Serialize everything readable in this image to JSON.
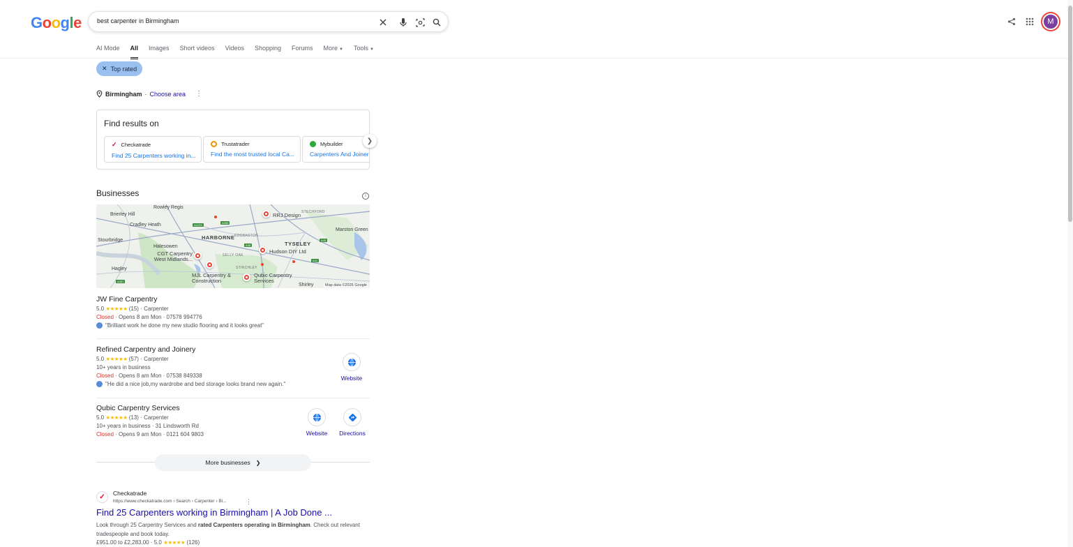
{
  "search": {
    "query": "best carpenter in Birmingham"
  },
  "tabs": [
    "AI Mode",
    "All",
    "Images",
    "Short videos",
    "Videos",
    "Shopping",
    "Forums",
    "More",
    "Tools"
  ],
  "filter_chip": "Top rated",
  "location": {
    "place": "Birmingham",
    "separator": "·",
    "choose": "Choose area"
  },
  "find_results": {
    "title": "Find results on",
    "providers": [
      {
        "name": "Checkatrade",
        "text": "Find 25 Carpenters working in..."
      },
      {
        "name": "Trustatrader",
        "text": "Find the most trusted local Ca..."
      },
      {
        "name": "Mybuilder",
        "text": "Carpenters And Joiners"
      }
    ]
  },
  "businesses": {
    "title": "Businesses",
    "map": {
      "labels": [
        "Rowley Regis",
        "Brierley Hill",
        "Cradley Heath",
        "Stourbridge",
        "Halesowen",
        "Hagley",
        "HARBORNE",
        "EDGBASTON",
        "TYSELEY",
        "SELLY OAK",
        "STIRCHLEY",
        "STECHFORD",
        "Marston Green",
        "Shirley"
      ],
      "pins": [
        "RRJ Design",
        "Hudson DIY Ltd",
        "CGT Carpentry West Midlands...",
        "MJL Carpentry & Construction",
        "Qubic Carpentry Services"
      ],
      "roads": [
        "A4123",
        "A456",
        "A38",
        "A45",
        "A41",
        "A451"
      ],
      "credit": "Map data ©2026 Google"
    },
    "listings": [
      {
        "name": "JW Fine Carpentry",
        "rating": "5.0",
        "stars": "★★★★★",
        "count": "(15)",
        "category": "· Carpenter",
        "extra": "",
        "status": "Closed",
        "hours": "· Opens 8 am Mon · 07578 994776",
        "review": "\"Brilliant work he done my new studio flooring and it looks great\""
      },
      {
        "name": "Refined Carpentry and Joinery",
        "rating": "5.0",
        "stars": "★★★★★",
        "count": "(57)",
        "category": "· Carpenter",
        "extra": "10+ years in business",
        "status": "Closed",
        "hours": "· Opens 8 am Mon · 07538 849338",
        "review": "\"He did a nice job,my wardrobe and bed storage looks brand new again.\""
      },
      {
        "name": "Qubic Carpentry Services",
        "rating": "5.0",
        "stars": "★★★★★",
        "count": "(13)",
        "category": "· Carpenter",
        "extra": "10+ years in business · 31 Lindsworth Rd",
        "status": "Closed",
        "hours": "· Opens 9 am Mon · 0121 604 9803",
        "review": ""
      }
    ],
    "actions": {
      "website": "Website",
      "directions": "Directions"
    },
    "more": "More businesses"
  },
  "organic": {
    "site": "Checkatrade",
    "url": "https://www.checkatrade.com › Search › Carpenter › Bi...",
    "title": "Find 25 Carpenters working in Birmingham | A Job Done ...",
    "snippet_1": "Look through 25 Carpentry Services and ",
    "snippet_b1": "rated Carpenters operating in Birmingham",
    "snippet_2": ". Check out relevant tradespeople and book today.",
    "price": "£951.00 to £2,283.00 · 5.0",
    "price_stars": "★★★★★",
    "price_count": "(126)"
  },
  "avatar_initial": "M",
  "colors": {
    "link": "#1a0dab",
    "closed": "#d93025",
    "star": "#fbbc04",
    "chip": "#9ac0f0",
    "pin": "#ea4335"
  }
}
